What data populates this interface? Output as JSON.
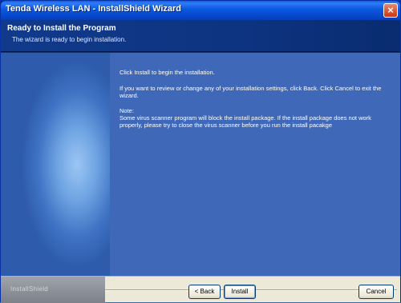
{
  "window": {
    "title": "Tenda Wireless LAN - InstallShield Wizard",
    "close_glyph": "×"
  },
  "header": {
    "heading": "Ready to Install the Program",
    "subheading": "The wizard is ready to begin installation."
  },
  "content": {
    "line1": "Click Install to begin the installation.",
    "line2": "If you want to review or change any of your installation settings, click Back. Click Cancel to exit the wizard.",
    "note_label": "Note:",
    "note_text": "Some virus scanner program will block the install package. If the install package does not work properly, please try to close the virus scanner before you run the install pacakge"
  },
  "footer": {
    "brand": "InstallShield",
    "back_label": "< Back",
    "install_label": "Install",
    "cancel_label": "Cancel"
  }
}
